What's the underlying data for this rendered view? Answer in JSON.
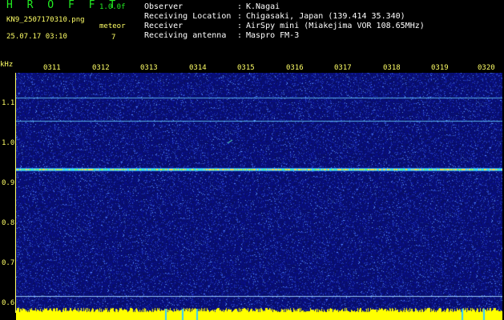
{
  "header": {
    "title": "H R O F F T",
    "version": "1.0.0f",
    "filename": "KN9_2507170310.png",
    "datetime": "25.07.17 03:10",
    "meteor_label": "meteor",
    "meteor_count": "7"
  },
  "info": [
    {
      "label": "Observer",
      "value": "K.Nagai"
    },
    {
      "label": "Receiving Location",
      "value": "Chigasaki, Japan (139.414 35.340)"
    },
    {
      "label": "Receiver",
      "value": "AirSpy mini (Miakejima VOR 108.65MHz)"
    },
    {
      "label": "Receiving antenna",
      "value": "Maspro FM-3"
    }
  ],
  "axis": {
    "unit": "kHz",
    "y_ticks": [
      "1.1",
      "1.0",
      "0.9",
      "0.8",
      "0.7",
      "0.6"
    ],
    "x_ticks": [
      "0311",
      "0312",
      "0313",
      "0314",
      "0315",
      "0316",
      "0317",
      "0318",
      "0319",
      "0320"
    ]
  },
  "colors": {
    "background": "#000000",
    "label": "#ffff66",
    "title": "#22ee22",
    "noise_base": "#0a1466",
    "signal": "#00ff88",
    "baseline": "#ffff00"
  }
}
